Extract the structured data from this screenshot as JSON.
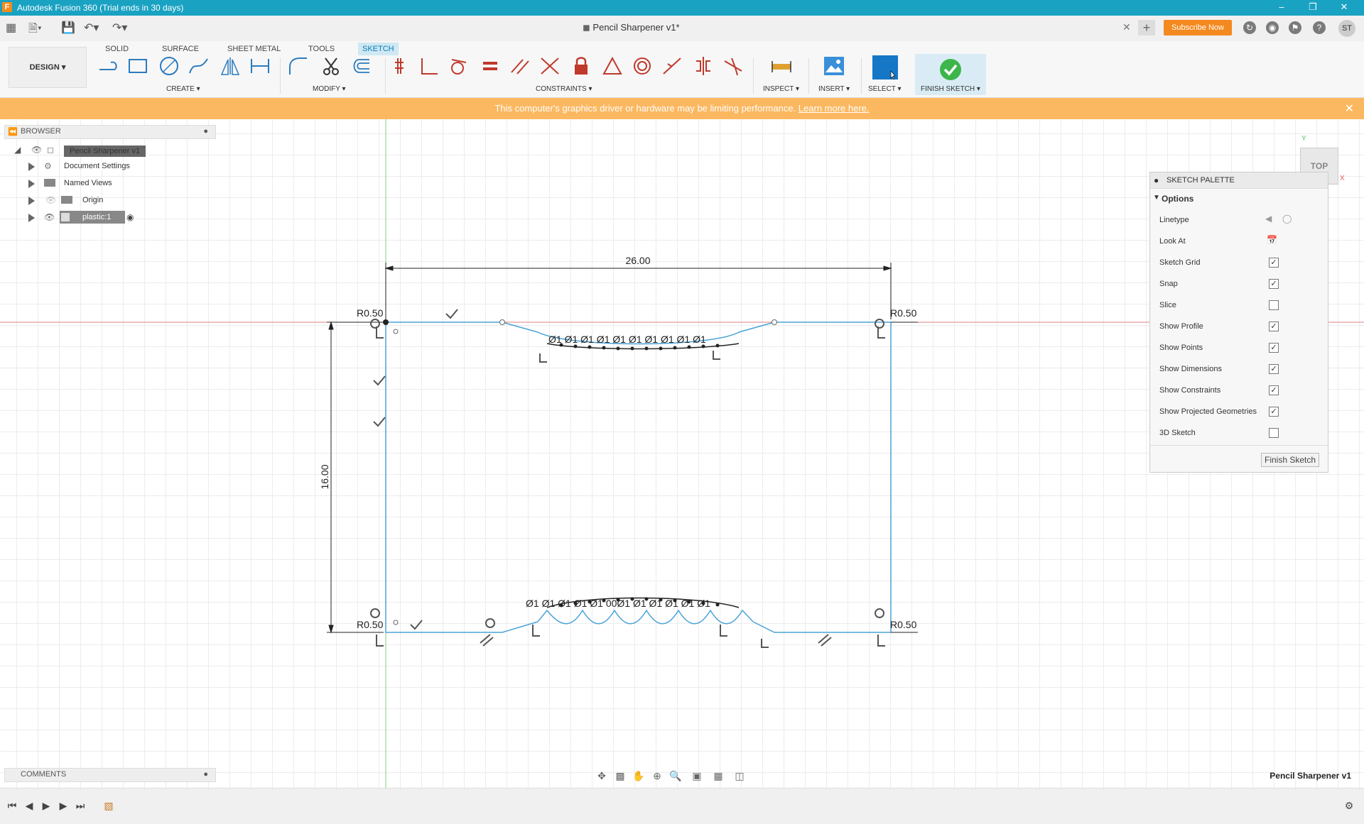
{
  "window": {
    "app_title": "Autodesk Fusion 360 (Trial ends in 30 days)",
    "doc_tab_title": "Pencil Sharpener v1*"
  },
  "header": {
    "subscribe_label": "Subscribe Now",
    "avatar_initials": "ST"
  },
  "workspace_tabs": [
    {
      "label": "SOLID",
      "active": false
    },
    {
      "label": "SURFACE",
      "active": false
    },
    {
      "label": "SHEET METAL",
      "active": false
    },
    {
      "label": "TOOLS",
      "active": false
    },
    {
      "label": "SKETCH",
      "active": true
    }
  ],
  "toolbar": {
    "design_label": "DESIGN ▾",
    "groups": {
      "create": "CREATE ▾",
      "modify": "MODIFY ▾",
      "constraints": "CONSTRAINTS ▾",
      "inspect": "INSPECT ▾",
      "insert": "INSERT ▾",
      "select": "SELECT ▾",
      "finish_sketch": "FINISH SKETCH ▾"
    }
  },
  "banner": {
    "message": "This computer's graphics driver or hardware may be limiting performance.",
    "link": "Learn more here.",
    "color": "#fbb860"
  },
  "browser": {
    "title": "BROWSER",
    "items": [
      {
        "label": "Pencil Sharpener v1",
        "icon": "component-icon"
      },
      {
        "label": "Document Settings",
        "icon": "gear-icon"
      },
      {
        "label": "Named Views",
        "icon": "folder-icon"
      },
      {
        "label": "Origin",
        "icon": "folder-icon"
      },
      {
        "label": "plastic:1",
        "icon": "body-icon"
      }
    ]
  },
  "comments": {
    "title": "COMMENTS"
  },
  "sketch_palette": {
    "title": "SKETCH PALETTE",
    "section": "Options",
    "linetype_label": "Linetype",
    "look_at_label": "Look At",
    "options": [
      {
        "label": "Sketch Grid",
        "checked": true
      },
      {
        "label": "Snap",
        "checked": true
      },
      {
        "label": "Slice",
        "checked": false
      },
      {
        "label": "Show Profile",
        "checked": true
      },
      {
        "label": "Show Points",
        "checked": true
      },
      {
        "label": "Show Dimensions",
        "checked": true
      },
      {
        "label": "Show Constraints",
        "checked": true
      },
      {
        "label": "Show Projected Geometries",
        "checked": true
      },
      {
        "label": "3D Sketch",
        "checked": false
      }
    ],
    "finish_button": "Finish Sketch"
  },
  "viewcube": {
    "face": "TOP"
  },
  "sketch": {
    "dim_width": "26.00",
    "dim_height": "16.00",
    "radius_top_left": "R0.50",
    "radius_top_right": "R0.50",
    "radius_bottom_left": "R0.50",
    "radius_bottom_right": "R0.50",
    "top_scribble": "Ø1 Ø1 Ø1 Ø1 Ø1 Ø1 Ø1 Ø1 Ø1 Ø1",
    "bottom_scribble": "Ø1 Ø1 Ø1 Ø1 Ø1 00Ø1 Ø1 Ø1 Ø1 Ø1 Ø1"
  },
  "status": {
    "document_name": "Pencil Sharpener v1"
  },
  "colors": {
    "title_bar": "#1aa2c2",
    "sketch_line": "#4aa3d6",
    "x_axis": "#e08080",
    "y_axis": "#80d080",
    "accent": "#f4891f"
  }
}
